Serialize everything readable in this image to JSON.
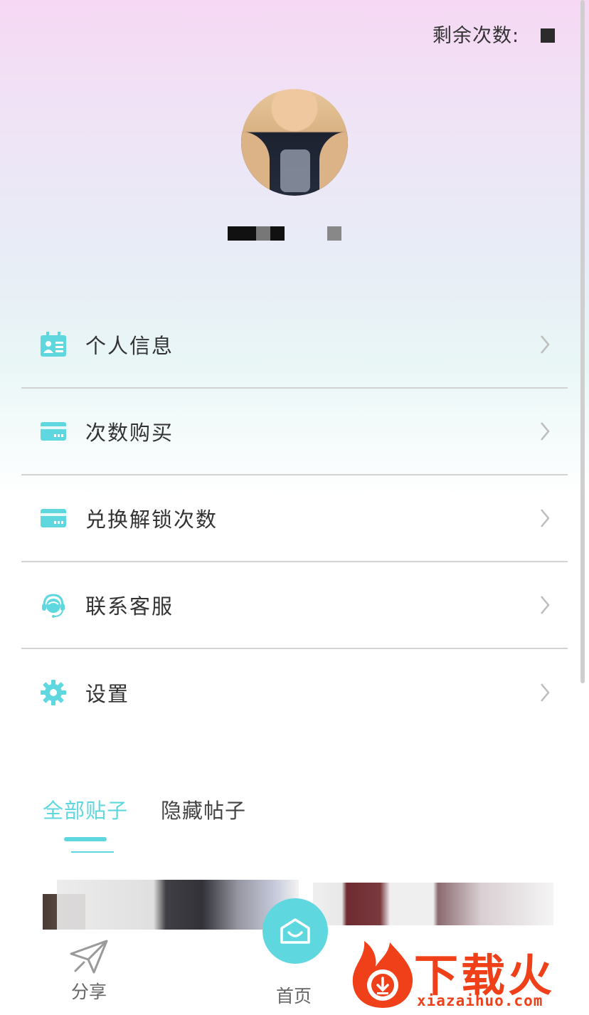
{
  "header": {
    "remaining_label": "剩余次数:"
  },
  "colors": {
    "accent": "#5fd7de",
    "text": "#333333",
    "divider": "#d2d2d2",
    "watermark": "#f0401a"
  },
  "menu": {
    "items": [
      {
        "label": "个人信息",
        "icon": "id-card-icon"
      },
      {
        "label": "次数购买",
        "icon": "credit-card-icon"
      },
      {
        "label": "兑换解锁次数",
        "icon": "credit-card-icon"
      },
      {
        "label": "联系客服",
        "icon": "headset-icon"
      },
      {
        "label": "设置",
        "icon": "gear-icon"
      }
    ]
  },
  "tabs": [
    {
      "label": "全部贴子",
      "active": true
    },
    {
      "label": "隐藏帖子",
      "active": false
    }
  ],
  "bottom_nav": {
    "items": [
      {
        "label": "分享",
        "icon": "paper-plane-icon"
      },
      {
        "label": "首页",
        "icon": "home-smile-icon"
      }
    ]
  },
  "watermark": {
    "text": "下载火",
    "url": "xiazaihuo.com"
  }
}
